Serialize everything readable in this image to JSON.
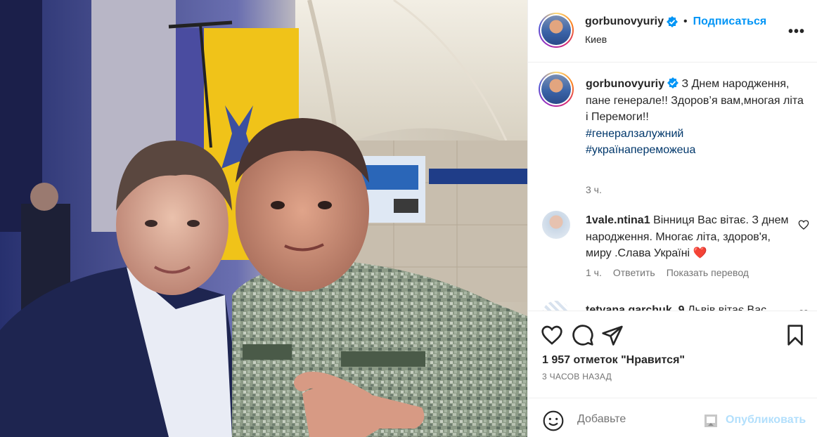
{
  "photo": {
    "alt_icon": "post-photo"
  },
  "header": {
    "username": "gorbunovyuriy",
    "dot": "•",
    "follow_label": "Подписаться",
    "location": "Киев",
    "more_label": "•••"
  },
  "caption": {
    "username": "gorbunovyuriy",
    "text": "З Днем народження, пане генерале!! Здоров’я вам,многая літа і Перемоги!!",
    "hashtags": [
      "#генералзалужний",
      "#українапереможеua"
    ],
    "time": "3 ч."
  },
  "comments": [
    {
      "username": "1vale.ntina1",
      "text": "Вінниця Вас вітає. З днем народження. Многає літа, здоров'я, миру .Слава Україні",
      "emoji": "❤️",
      "time": "1 ч.",
      "reply_label": "Ответить",
      "translate_label": "Показать перевод"
    },
    {
      "username": "tetyana.garchuk_9",
      "text": "Львів вітає Вас"
    }
  ],
  "actions": {
    "likes": "1 957 отметок \"Нравится\"",
    "ago": "3 ЧАСОВ НАЗАД"
  },
  "add_comment": {
    "placeholder": "Добавьте",
    "publish_label": "Опубликовать"
  },
  "colors": {
    "accent": "#0095f6",
    "hashtag": "#00376b",
    "muted": "#737373",
    "heart": "#ed4956",
    "publish_disabled": "#b2dffc"
  }
}
